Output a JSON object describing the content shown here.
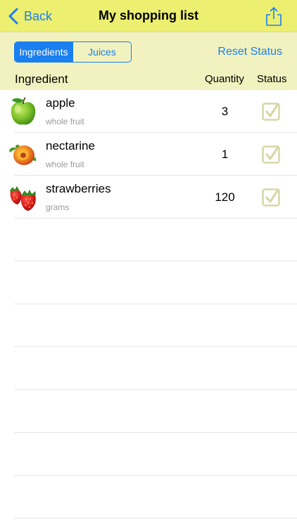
{
  "navbar": {
    "back_label": "Back",
    "title": "My shopping list",
    "back_icon": "chevron-left-icon",
    "share_icon": "share-icon"
  },
  "segments": [
    {
      "label": "Ingredients",
      "selected": true
    },
    {
      "label": "Juices",
      "selected": false
    }
  ],
  "reset_label": "Reset Status",
  "columns": {
    "ingredient": "Ingredient",
    "quantity": "Quantity",
    "status": "Status"
  },
  "items": [
    {
      "name": "apple",
      "unit": "whole fruit",
      "quantity": "3",
      "icon": "apple-icon",
      "checked": true
    },
    {
      "name": "nectarine",
      "unit": "whole fruit",
      "quantity": "1",
      "icon": "nectarine-icon",
      "checked": true
    },
    {
      "name": "strawberries",
      "unit": "grams",
      "quantity": "120",
      "icon": "strawberry-icon",
      "checked": true
    }
  ],
  "colors": {
    "accent": "#1a7ff0",
    "navbar": "#ecef6f",
    "subbar": "#f1f2bf",
    "checkbox": "#d6d7a5"
  }
}
